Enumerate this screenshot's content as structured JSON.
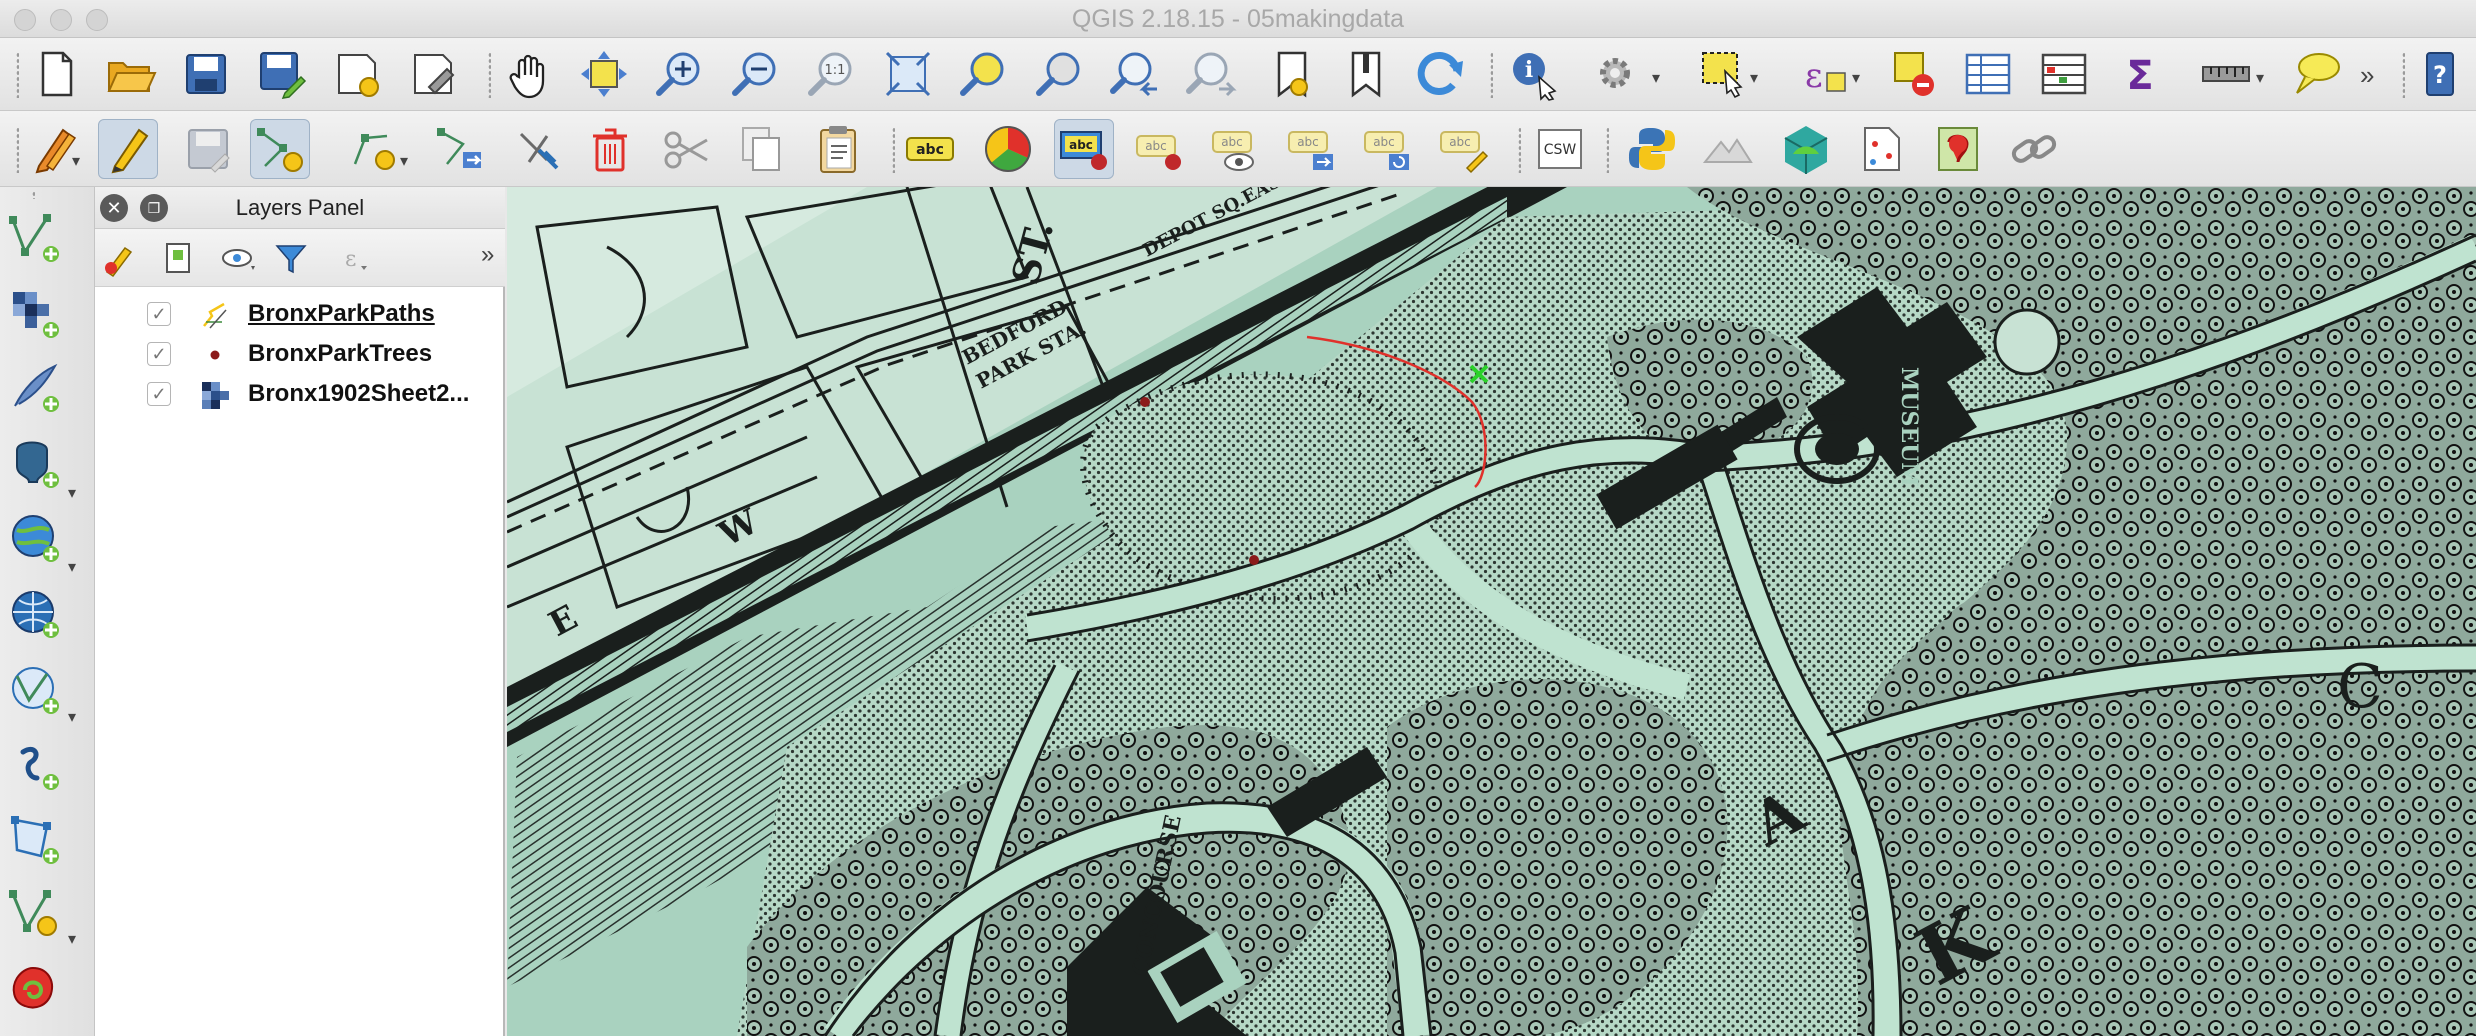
{
  "window": {
    "title": "QGIS 2.18.15 - 05makingdata"
  },
  "toolbar1": {
    "items": [
      "new-project",
      "open-project",
      "save-project",
      "save-project-as",
      "new-print-composer",
      "composer-manager",
      "pan-map",
      "pan-to-selection",
      "zoom-in",
      "zoom-out",
      "zoom-actual-size",
      "zoom-full",
      "zoom-to-selection",
      "zoom-to-layer",
      "zoom-last",
      "zoom-next",
      "new-bookmark",
      "show-bookmarks",
      "refresh",
      "identify-features",
      "run-feature-action",
      "select-features",
      "select-by-expression",
      "deselect-all",
      "open-attribute-table",
      "open-field-calculator",
      "show-statistical-summary",
      "measure-line",
      "text-annotation",
      "help"
    ],
    "zoom_actual_label": "1:1",
    "overflow_label": "»"
  },
  "toolbar2": {
    "items": [
      "current-edits",
      "toggle-editing",
      "save-layer-edits",
      "add-feature",
      "node-tool",
      "move-feature",
      "delete-selected",
      "cut-features",
      "copy-features",
      "paste-features",
      "layer-labeling",
      "layer-diagram",
      "highlight-pinned-labels",
      "pin-labels",
      "show-hide-labels",
      "move-label",
      "rotate-label",
      "change-label",
      "csw",
      "python-console",
      "gps",
      "add-layer-3d",
      "georeferencer",
      "processing-toolbox",
      "plugins"
    ],
    "label_abc": "abc",
    "csw_label": "CSW"
  },
  "leftdock": {
    "items": [
      "add-vector-layer",
      "add-raster-layer",
      "add-delimited-text-layer",
      "add-postgis-layer",
      "add-spatialite-layer",
      "add-wms-layer",
      "add-wfs-layer",
      "add-wcs-layer",
      "new-shapefile-layer",
      "new-spatialite-layer",
      "add-virtual-layer",
      "add-geonode-layer"
    ]
  },
  "layers_panel": {
    "title": "Layers Panel",
    "overflow_label": "»",
    "layers": [
      {
        "name": "BronxParkPaths",
        "checked": true,
        "type": "line",
        "current": true
      },
      {
        "name": "BronxParkTrees",
        "checked": true,
        "type": "point",
        "current": false
      },
      {
        "name": "Bronx1902Sheet2...",
        "checked": true,
        "type": "raster",
        "current": false
      }
    ],
    "check_glyph": "✓"
  },
  "map": {
    "labels": {
      "street1": "ST.",
      "street2": "DEPOT SQ.EAST",
      "station1": "BEDFORD",
      "station2": "PARK STA.",
      "museum": "MUSEUM",
      "walk": "W",
      "e": "E",
      "letter_a": "A",
      "letter_k": "K",
      "letter_c": "C",
      "road": "CONCOURSE"
    },
    "colors": {
      "paper": "#a9d2bf",
      "ink": "#1a1f1d",
      "edit_line": "#e0312b",
      "vertex_marker": "#2bd12b",
      "tree_point": "#8b1a1a"
    }
  }
}
